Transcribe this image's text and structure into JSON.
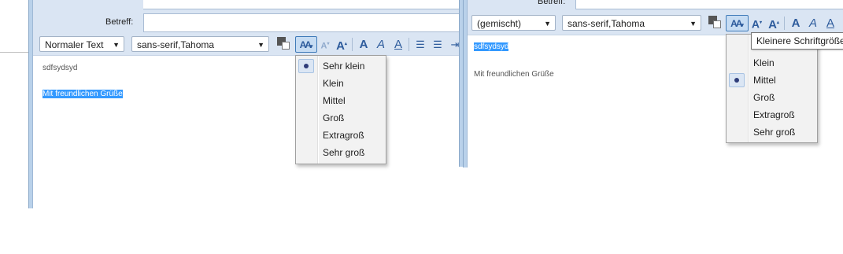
{
  "left": {
    "subject_label": "Betreff:",
    "paragraph_format": "Normaler Text",
    "font_family": "sans-serif,Tahoma",
    "body_line1": "sdfsydsyd",
    "body_line2": "Mit freundlichen Grüße",
    "size_menu": {
      "items": [
        "Sehr klein",
        "Klein",
        "Mittel",
        "Groß",
        "Extragroß",
        "Sehr groß"
      ],
      "selected": "Sehr klein"
    }
  },
  "right": {
    "subject_label": "Betreff:",
    "paragraph_format": "(gemischt)",
    "font_family": "sans-serif,Tahoma",
    "body_line1": "sdfsydsyd",
    "body_line2": "Mit freundlichen Grüße",
    "tooltip": "Kleinere Schriftgröße",
    "size_menu": {
      "items": [
        "Klein",
        "Mittel",
        "Groß",
        "Extragroß",
        "Sehr groß"
      ],
      "selected": "Mittel"
    }
  },
  "toolbar_glyphs": {
    "font_size_button": "AA",
    "smaller": "A",
    "larger": "A",
    "bold": "A",
    "italic": "A",
    "underline": "A",
    "bulleted_list": "☰",
    "numbered_list": "☰"
  },
  "colors": {
    "selection": "#3399ff",
    "toolbar_bg": "#dae5f3",
    "accent": "#2d5b9c"
  }
}
